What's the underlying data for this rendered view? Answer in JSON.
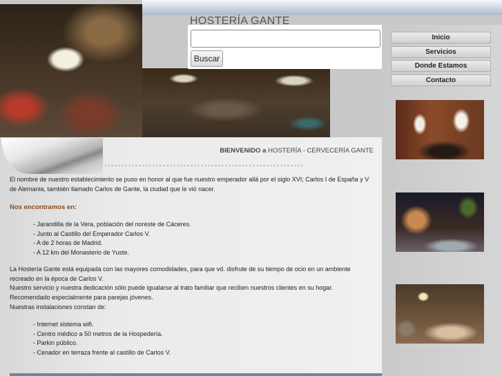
{
  "header": {
    "brand": "HOSTERÍA GANTE",
    "search": {
      "value": "",
      "placeholder": "",
      "button_label": "Buscar"
    }
  },
  "nav": {
    "items": [
      {
        "label": "Inicio"
      },
      {
        "label": "Servicios"
      },
      {
        "label": "Donde Estamos"
      },
      {
        "label": "Contacto"
      }
    ]
  },
  "main": {
    "welcome_bold": "BIENVENIDO a",
    "welcome_rest": " HOSTERÍA - CERVECERÍA GANTE",
    "intro": "El nombre de nuestro establecimiento se puso en honor al que fue nuestro emperador allá por el siglo XVI; Carlos I de España y V de Alemania, también llamado Carlos de Gante, la ciudad que le vió nacer.",
    "location_heading": "Nos encontramos en:",
    "location_items": [
      "- Jarandilla de la Vera, población del noreste de Cáceres.",
      "- Junto al Castillo del Emperador Carlos V.",
      "- A de 2 horas de Madrid.",
      "- A 12 km del Monasterio de Yuste."
    ],
    "description_lines": [
      "La Hostería Gante está equipada con las mayores comodidades, para que vd. disfrute de su tiempo de ocio en un ambiente recreado en la época de Carlos V.",
      "Nuestro servicio y nuestra dedicación sólo puede igualarse al trato familiar que reciben nuestros clientes en su hogar.",
      "Recomendado especialmente para parejas jóvenes.",
      "Nuestras instalaciones constan de:"
    ],
    "facility_items": [
      "- Internet sistema wifi.",
      "- Centro médico a 50 metros de la Hospedería.",
      "- Parkin público.",
      "- Cenador en terraza frente al castillo de Carlos V."
    ]
  }
}
